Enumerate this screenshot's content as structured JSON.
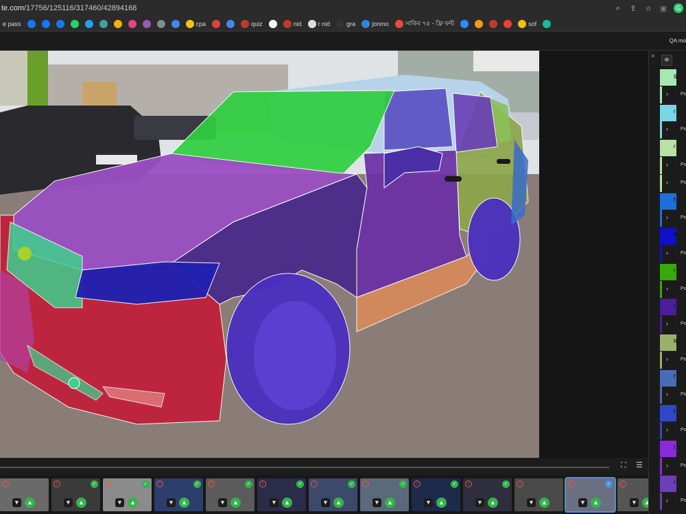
{
  "browser": {
    "url_host": "te.com",
    "url_path": "/17756/125116/317460/42894168"
  },
  "bookmarks": [
    {
      "label": "e pass",
      "color": "#2b2b2b"
    },
    {
      "label": "",
      "color": "#1877f2"
    },
    {
      "label": "",
      "color": "#1877f2"
    },
    {
      "label": "",
      "color": "#1877f2"
    },
    {
      "label": "",
      "color": "#25d366"
    },
    {
      "label": "",
      "color": "#1da1f2"
    },
    {
      "label": "",
      "color": "#3aa2a0"
    },
    {
      "label": "",
      "color": "#f4b400"
    },
    {
      "label": "",
      "color": "#e8447f"
    },
    {
      "label": "",
      "color": "#9b59b6"
    },
    {
      "label": "",
      "color": "#7f8c8d"
    },
    {
      "label": "",
      "color": "#4285f4"
    },
    {
      "label": "cpa",
      "color": "#f1c40f"
    },
    {
      "label": "",
      "color": "#db4437"
    },
    {
      "label": "",
      "color": "#4285f4"
    },
    {
      "label": "quiz",
      "color": "#c0392b"
    },
    {
      "label": "",
      "color": "#ffffff"
    },
    {
      "label": "nid",
      "color": "#c0392b"
    },
    {
      "label": "r nid",
      "color": "#dddddd"
    },
    {
      "label": "gra",
      "color": "#333333"
    },
    {
      "label": "jonmo",
      "color": "#2e86de"
    },
    {
      "label": "সাকিব ৭৫ - ফ্রি ফন্ট",
      "color": "#e74c3c"
    },
    {
      "label": "",
      "color": "#2d8cff"
    },
    {
      "label": "",
      "color": "#f39c12"
    },
    {
      "label": "",
      "color": "#c0392b"
    },
    {
      "label": "",
      "color": "#ea4335"
    },
    {
      "label": "sof",
      "color": "#fbbc05"
    },
    {
      "label": "",
      "color": "#1abc9c"
    }
  ],
  "tabs_right_label": "QA mo",
  "right_panel": {
    "collapse_icon": "»",
    "split_icon": "≑",
    "rows": [
      {
        "kind": "label",
        "color": "#a9e7b2",
        "text": "g"
      },
      {
        "kind": "polygon",
        "text": "Po"
      },
      {
        "kind": "label",
        "color": "#7dd3e8",
        "text": "r"
      },
      {
        "kind": "polygon",
        "text": "Po"
      },
      {
        "kind": "label",
        "color": "#b9e0a5",
        "text": "r"
      },
      {
        "kind": "polygon",
        "text": "Po"
      },
      {
        "kind": "polygon",
        "text": "Po"
      },
      {
        "kind": "label",
        "color": "#1e6fd9",
        "text": "f"
      },
      {
        "kind": "polygon",
        "text": "Po"
      },
      {
        "kind": "label",
        "color": "#1010c8",
        "text": "h"
      },
      {
        "kind": "polygon",
        "text": "Po"
      },
      {
        "kind": "label",
        "color": "#3aa80a",
        "text": "r"
      },
      {
        "kind": "polygon",
        "text": "Po"
      },
      {
        "kind": "label",
        "color": "#4b1e9a",
        "text": "r"
      },
      {
        "kind": "polygon",
        "text": "Po"
      },
      {
        "kind": "label",
        "color": "#9bb06a",
        "text": "b"
      },
      {
        "kind": "polygon",
        "text": "Po"
      },
      {
        "kind": "label",
        "color": "#4a6bb8",
        "text": "f"
      },
      {
        "kind": "polygon",
        "text": "Po"
      },
      {
        "kind": "label",
        "color": "#3047c9",
        "text": "f"
      },
      {
        "kind": "polygon",
        "text": "Po"
      },
      {
        "kind": "label",
        "color": "#8a2bd9",
        "text": "t"
      },
      {
        "kind": "polygon",
        "text": "Po"
      },
      {
        "kind": "label",
        "color": "#6b3fb8",
        "text": "r"
      },
      {
        "kind": "polygon",
        "text": "Po"
      }
    ]
  },
  "thumbnails": [
    {
      "bg": "#6a6a6a",
      "status": "none"
    },
    {
      "bg": "#3a3a3a",
      "status": "done"
    },
    {
      "bg": "#8b8b8b",
      "status": "done"
    },
    {
      "bg": "#2c3e6b",
      "status": "done"
    },
    {
      "bg": "#5b5b5b",
      "status": "done"
    },
    {
      "bg": "#2b2b4a",
      "status": "done"
    },
    {
      "bg": "#3b4a6a",
      "status": "done"
    },
    {
      "bg": "#5a6a7a",
      "status": "done"
    },
    {
      "bg": "#1e2a4a",
      "status": "done"
    },
    {
      "bg": "#2e2e3e",
      "status": "done"
    },
    {
      "bg": "#4a4a4a",
      "status": "none"
    },
    {
      "bg": "#6a7080",
      "status": "selected"
    },
    {
      "bg": "#555555",
      "status": "none"
    }
  ],
  "colors": {
    "windshield": "#2fcf3f",
    "hood": "#9a4fc2",
    "bumper": "#c21e3a",
    "fender": "#4a2a8a",
    "wheel": "#4a2fbf",
    "door_front": "#6a2fa6",
    "door_rear": "#8ea64a",
    "sill": "#d98a5a",
    "grille": "#3fcf8f",
    "headlight": "#2020b0",
    "roof": "#9cc2e6"
  }
}
